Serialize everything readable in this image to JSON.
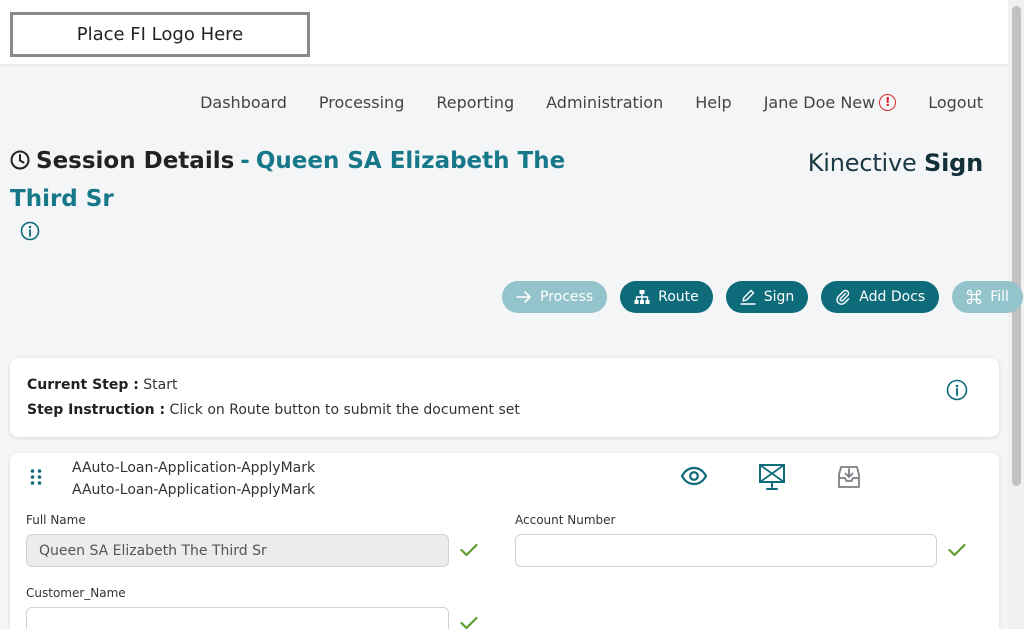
{
  "logo": {
    "text": "Place FI Logo Here"
  },
  "nav": {
    "dashboard": "Dashboard",
    "processing": "Processing",
    "reporting": "Reporting",
    "administration": "Administration",
    "help": "Help",
    "user": "Jane Doe New",
    "logout": "Logout"
  },
  "header": {
    "title": "Session Details",
    "separator": "-",
    "session_name": "Queen SA Elizabeth The Third Sr"
  },
  "brand": {
    "prefix": "Kinective",
    "suffix": "Sign"
  },
  "actions": {
    "process": "Process",
    "route": "Route",
    "sign": "Sign",
    "add_docs": "Add Docs",
    "fill": "Fill"
  },
  "step": {
    "current_label": "Current Step :",
    "current_value": "Start",
    "instruction_label": "Step Instruction :",
    "instruction_value": "Click on Route button to submit the document set"
  },
  "document": {
    "name_line1": "AAuto-Loan-Application-ApplyMark",
    "name_line2": "AAuto-Loan-Application-ApplyMark",
    "fields": {
      "full_name_label": "Full Name",
      "full_name_value": "Queen SA Elizabeth The Third Sr",
      "account_number_label": "Account Number",
      "account_number_value": "",
      "customer_name_label": "Customer_Name",
      "customer_name_value": ""
    }
  },
  "colors": {
    "accent": "#0e6b7a",
    "accent_text": "#167889",
    "disabled": "#94c4cb",
    "check": "#5aa02c",
    "alert": "#d9262a"
  }
}
